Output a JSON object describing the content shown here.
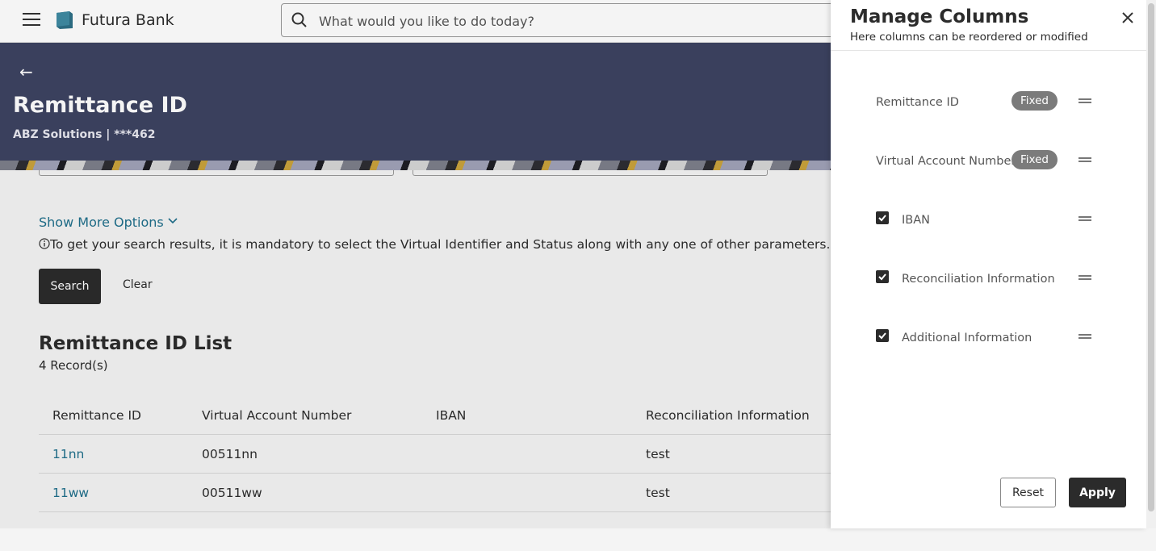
{
  "header": {
    "brand": "Futura Bank",
    "search_placeholder": "What would you like to do today?"
  },
  "hero": {
    "back_symbol": "←",
    "title": "Remittance ID",
    "subtitle": "ABZ Solutions | ***462"
  },
  "filters": {
    "show_more": "Show More Options",
    "note": "To get your search results, it is mandatory to select the Virtual Identifier and Status along with any one of other parameters.",
    "search_label": "Search",
    "clear_label": "Clear"
  },
  "list": {
    "title": "Remittance ID List",
    "count": "4 Record(s)",
    "columns": [
      "Remittance ID",
      "Virtual Account Number",
      "IBAN",
      "Reconciliation Information"
    ],
    "rows": [
      {
        "remittance_id": "11nn",
        "van": "00511nn",
        "iban": "",
        "recon": "test"
      },
      {
        "remittance_id": "11ww",
        "van": "00511ww",
        "iban": "",
        "recon": "test"
      }
    ]
  },
  "panel": {
    "title": "Manage Columns",
    "subtitle": "Here columns can be reordered or modified",
    "fixed_label": "Fixed",
    "columns": [
      {
        "label": "Remittance ID",
        "fixed": true
      },
      {
        "label": "Virtual Account Number",
        "fixed": true
      },
      {
        "label": "IBAN",
        "checked": true
      },
      {
        "label": "Reconciliation Information",
        "checked": true
      },
      {
        "label": "Additional Information",
        "checked": true
      }
    ],
    "reset_label": "Reset",
    "apply_label": "Apply"
  },
  "colors": {
    "hero_bg": "#3d4362",
    "primary_button": "#2b2b2b",
    "link": "#1f6f8b",
    "badge": "#7b7b7b"
  },
  "icons": [
    "hamburger-icon",
    "bank-logo-icon",
    "search-icon",
    "back-arrow-icon",
    "chevron-down-icon",
    "info-icon",
    "close-icon",
    "checkbox-checked-icon",
    "drag-handle-icon"
  ]
}
